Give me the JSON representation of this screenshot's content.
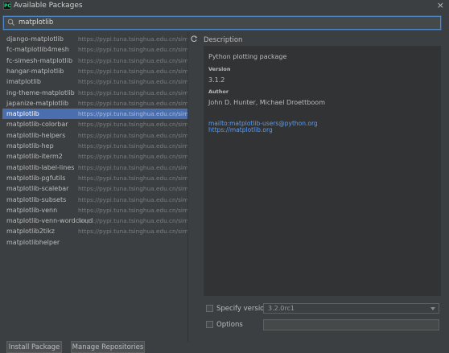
{
  "window": {
    "title": "Available Packages",
    "icon": "pycharm-icon"
  },
  "search": {
    "value": "matplotlib"
  },
  "packages": [
    {
      "name": "django-matplotlib",
      "repo": "https://pypi.tuna.tsinghua.edu.cn/simple/"
    },
    {
      "name": "fc-matplotlib4mesh",
      "repo": "https://pypi.tuna.tsinghua.edu.cn/simple/"
    },
    {
      "name": "fc-simesh-matplotlib",
      "repo": "https://pypi.tuna.tsinghua.edu.cn/simple/"
    },
    {
      "name": "hangar-matplotlib",
      "repo": "https://pypi.tuna.tsinghua.edu.cn/simple/"
    },
    {
      "name": "imatplotlib",
      "repo": "https://pypi.tuna.tsinghua.edu.cn/simple/"
    },
    {
      "name": "ing-theme-matplotlib",
      "repo": "https://pypi.tuna.tsinghua.edu.cn/simple/"
    },
    {
      "name": "japanize-matplotlib",
      "repo": "https://pypi.tuna.tsinghua.edu.cn/simple/"
    },
    {
      "name": "matplotlib",
      "repo": "https://pypi.tuna.tsinghua.edu.cn/simple/",
      "selected": true
    },
    {
      "name": "matplotlib-colorbar",
      "repo": "https://pypi.tuna.tsinghua.edu.cn/simple/"
    },
    {
      "name": "matplotlib-helpers",
      "repo": "https://pypi.tuna.tsinghua.edu.cn/simple/"
    },
    {
      "name": "matplotlib-hep",
      "repo": "https://pypi.tuna.tsinghua.edu.cn/simple/"
    },
    {
      "name": "matplotlib-iterm2",
      "repo": "https://pypi.tuna.tsinghua.edu.cn/simple/"
    },
    {
      "name": "matplotlib-label-lines",
      "repo": "https://pypi.tuna.tsinghua.edu.cn/simple/"
    },
    {
      "name": "matplotlib-pgfutils",
      "repo": "https://pypi.tuna.tsinghua.edu.cn/simple/"
    },
    {
      "name": "matplotlib-scalebar",
      "repo": "https://pypi.tuna.tsinghua.edu.cn/simple/"
    },
    {
      "name": "matplotlib-subsets",
      "repo": "https://pypi.tuna.tsinghua.edu.cn/simple/"
    },
    {
      "name": "matplotlib-venn",
      "repo": "https://pypi.tuna.tsinghua.edu.cn/simple/"
    },
    {
      "name": "matplotlib-venn-wordcloud",
      "repo": "https://pypi.tuna.tsinghua.edu.cn/simple/"
    },
    {
      "name": "matplotlib2tikz",
      "repo": "https://pypi.tuna.tsinghua.edu.cn/simple/"
    },
    {
      "name": "matplotlibhelper",
      "repo": ""
    }
  ],
  "description": {
    "header": "Description",
    "summary": "Python plotting package",
    "version_label": "Version",
    "version": "3.1.2",
    "author_label": "Author",
    "author": "John D. Hunter, Michael Droettboom",
    "email_link": "mailto:matplotlib-users@python.org",
    "home_link": "https://matplotlib.org"
  },
  "options": {
    "specify_version_label": "Specify version",
    "version_value": "3.2.0rc1",
    "options_label": "Options",
    "options_value": ""
  },
  "buttons": {
    "install": "Install Package",
    "manage": "Manage Repositories"
  },
  "colors": {
    "selection": "#4b6eaf",
    "link": "#589df6",
    "focus_border": "#4a88c7"
  }
}
